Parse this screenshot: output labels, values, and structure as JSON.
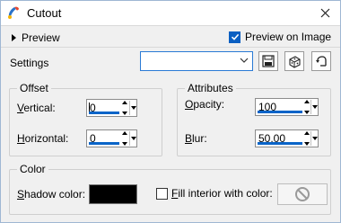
{
  "window": {
    "title": "Cutout",
    "icons": {
      "app": "paint-brush-app-icon",
      "close": "close-icon"
    }
  },
  "preview": {
    "toggle_label": "Preview",
    "preview_on_image_label": "Preview on Image",
    "preview_on_image_checked": true
  },
  "settings": {
    "label": "Settings",
    "preset_value": "",
    "buttons": [
      {
        "name": "save-preset",
        "icon": "save-icon"
      },
      {
        "name": "randomize",
        "icon": "dice-icon"
      },
      {
        "name": "reset",
        "icon": "reset-icon"
      }
    ]
  },
  "offset": {
    "group_label": "Offset",
    "vertical_label": "Vertical:",
    "vertical_value": "0",
    "horizontal_label": "Horizontal:",
    "horizontal_value": "0"
  },
  "attributes": {
    "group_label": "Attributes",
    "opacity_label": "Opacity:",
    "opacity_value": "100",
    "blur_label": "Blur:",
    "blur_value": "50,00"
  },
  "color": {
    "group_label": "Color",
    "shadow_color_label": "Shadow color:",
    "shadow_color_value": "#000000",
    "fill_interior_label": "Fill interior with color:",
    "fill_interior_checked": false
  }
}
